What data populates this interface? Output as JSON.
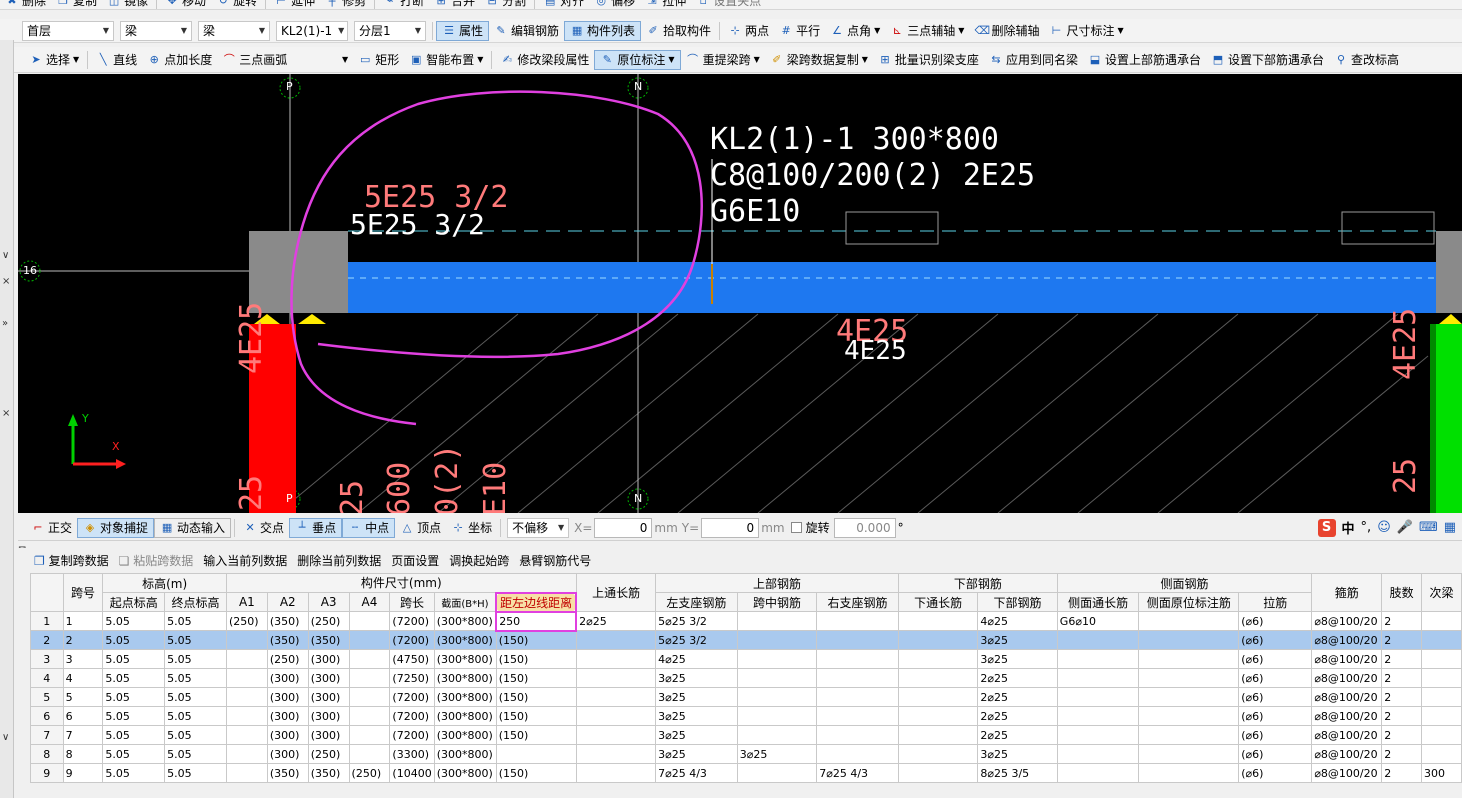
{
  "toolbar_top": [
    "删除",
    "复制",
    "镜像",
    "移动",
    "旋转",
    "延伸",
    "修剪",
    "打断",
    "合并",
    "分割",
    "对齐",
    "偏移",
    "拉伸",
    "设置夹点"
  ],
  "toolbar1": {
    "combos": [
      "首层",
      "梁",
      "梁",
      "KL2(1)-1",
      "分层1"
    ],
    "buttons": [
      {
        "label": "属性",
        "active": true
      },
      {
        "label": "编辑钢筋",
        "active": false
      },
      {
        "label": "构件列表",
        "active": true
      },
      {
        "label": "拾取构件",
        "active": false
      },
      {
        "label": "两点",
        "active": false
      },
      {
        "label": "平行",
        "active": false
      },
      {
        "label": "点角",
        "active": false
      },
      {
        "label": "三点辅轴",
        "active": false
      },
      {
        "label": "删除辅轴",
        "active": false
      },
      {
        "label": "尺寸标注",
        "active": false
      }
    ]
  },
  "toolbar2": {
    "select": "选择",
    "line": "直线",
    "point_length": "点加长度",
    "arc": "三点画弧",
    "rect": "矩形",
    "smart": "智能布置",
    "modify": "修改梁段属性",
    "origin": "原位标注",
    "reextract": "重提梁跨",
    "copy_span": "梁跨数据复制",
    "batch": "批量识别梁支座",
    "apply_same": "应用到同名梁",
    "top_bearing": "设置上部筋遇承台",
    "bottom_bearing": "设置下部筋遇承台",
    "check_elev": "查改标高"
  },
  "canvas": {
    "axis_p": "P",
    "axis_n": "N",
    "axis_16": "16",
    "ann_title": "KL2(1)-1 300*800",
    "ann_stirrup": "C8@100/200(2) 2E25",
    "ann_side": "G6E10",
    "top_left_red": "5E25 3/2",
    "top_left_white": "5E25 3/2",
    "bottom_red": "4E25",
    "bottom_white": "4E25",
    "col_left_text": "4E25",
    "col_left_text2": "25",
    "col_right_text": "4E25",
    "col_right_text2": "25",
    "vert_texts": [
      "25",
      "600",
      "0(2)",
      "E10"
    ],
    "ucs_y": "Y",
    "ucs_x": "X"
  },
  "snapbar": {
    "ortho": "正交",
    "snap": "对象捕捉",
    "dynamic": "动态输入",
    "intersect": "交点",
    "perp": "垂点",
    "mid": "中点",
    "vertex": "顶点",
    "coord": "坐标",
    "offset_mode": "不偏移",
    "x_label": "X=",
    "x_value": "0",
    "unit1": "mm",
    "y_label": "Y=",
    "y_value": "0",
    "unit2": "mm",
    "rotate": "旋转",
    "rotate_value": "0.000",
    "deg": "°"
  },
  "gridbar": [
    "复制跨数据",
    "粘贴跨数据",
    "输入当前列数据",
    "删除当前列数据",
    "页面设置",
    "调换起始跨",
    "悬臂钢筋代号"
  ],
  "table": {
    "group_headers": {
      "span": "跨号",
      "elev": "标高(m)",
      "size": "构件尺寸(mm)",
      "top_long": "上通长筋",
      "top_rebar": "上部钢筋",
      "bottom_rebar": "下部钢筋",
      "side_rebar": "侧面钢筋",
      "stirrup": "箍筋",
      "legs": "肢数",
      "secondary": "次梁"
    },
    "sub_headers": [
      "起点标高",
      "终点标高",
      "A1",
      "A2",
      "A3",
      "A4",
      "跨长",
      "截面(B*H)",
      "距左边线距离",
      "左支座钢筋",
      "跨中钢筋",
      "右支座钢筋",
      "下通长筋",
      "下部钢筋",
      "侧面通长筋",
      "侧面原位标注筋",
      "拉筋"
    ],
    "rows": [
      [
        "1",
        "1",
        "5.05",
        "5.05",
        "(250)",
        "(350)",
        "(250)",
        "",
        "(7200)",
        "(300*800)",
        "250",
        "2⌀25",
        "5⌀25 3/2",
        "",
        "",
        "",
        "4⌀25",
        "G6⌀10",
        "",
        "(⌀6)",
        "⌀8@100/20",
        "2",
        ""
      ],
      [
        "2",
        "2",
        "5.05",
        "5.05",
        "",
        "(350)",
        "(350)",
        "",
        "(7200)",
        "(300*800)",
        "(150)",
        "",
        "5⌀25 3/2",
        "",
        "",
        "",
        "3⌀25",
        "",
        "",
        "(⌀6)",
        "⌀8@100/20",
        "2",
        ""
      ],
      [
        "3",
        "3",
        "5.05",
        "5.05",
        "",
        "(250)",
        "(300)",
        "",
        "(4750)",
        "(300*800)",
        "(150)",
        "",
        "4⌀25",
        "",
        "",
        "",
        "3⌀25",
        "",
        "",
        "(⌀6)",
        "⌀8@100/20",
        "2",
        ""
      ],
      [
        "4",
        "4",
        "5.05",
        "5.05",
        "",
        "(300)",
        "(300)",
        "",
        "(7250)",
        "(300*800)",
        "(150)",
        "",
        "3⌀25",
        "",
        "",
        "",
        "2⌀25",
        "",
        "",
        "(⌀6)",
        "⌀8@100/20",
        "2",
        ""
      ],
      [
        "5",
        "5",
        "5.05",
        "5.05",
        "",
        "(300)",
        "(300)",
        "",
        "(7200)",
        "(300*800)",
        "(150)",
        "",
        "3⌀25",
        "",
        "",
        "",
        "2⌀25",
        "",
        "",
        "(⌀6)",
        "⌀8@100/20",
        "2",
        ""
      ],
      [
        "6",
        "6",
        "5.05",
        "5.05",
        "",
        "(300)",
        "(300)",
        "",
        "(7200)",
        "(300*800)",
        "(150)",
        "",
        "3⌀25",
        "",
        "",
        "",
        "2⌀25",
        "",
        "",
        "(⌀6)",
        "⌀8@100/20",
        "2",
        ""
      ],
      [
        "7",
        "7",
        "5.05",
        "5.05",
        "",
        "(300)",
        "(300)",
        "",
        "(7200)",
        "(300*800)",
        "(150)",
        "",
        "3⌀25",
        "",
        "",
        "",
        "2⌀25",
        "",
        "",
        "(⌀6)",
        "⌀8@100/20",
        "2",
        ""
      ],
      [
        "8",
        "8",
        "5.05",
        "5.05",
        "",
        "(300)",
        "(250)",
        "",
        "(3300)",
        "(300*800)",
        "",
        "",
        "3⌀25",
        "3⌀25",
        "",
        "",
        "3⌀25",
        "",
        "",
        "(⌀6)",
        "⌀8@100/20",
        "2",
        ""
      ],
      [
        "9",
        "9",
        "5.05",
        "5.05",
        "",
        "(350)",
        "(350)",
        "(250)",
        "(10400",
        "(300*800)",
        "(150)",
        "",
        "7⌀25 4/3",
        "",
        "7⌀25 4/3",
        "",
        "8⌀25 3/5",
        "",
        "",
        "(⌀6)",
        "⌀8@100/20",
        "2",
        "300"
      ]
    ],
    "selected_row": 2
  },
  "colors": {
    "canvas_bg": "#000000",
    "beam": "#1e78f0",
    "support": "#8a8a8a",
    "column_red": "#ff0000",
    "column_green": "#00e000",
    "annotation_red": "#ff7a7a",
    "highlight_magenta": "#e040e0",
    "dash_cyan": "#5ad2e6"
  }
}
